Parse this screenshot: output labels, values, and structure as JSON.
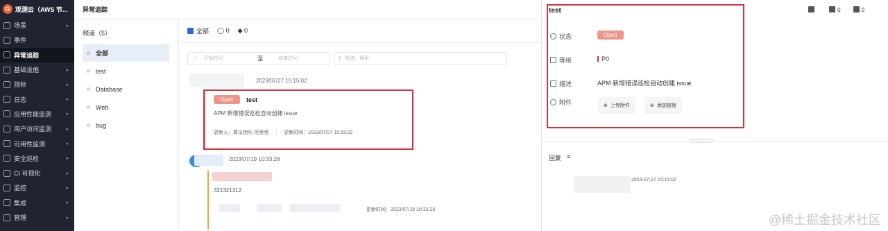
{
  "sidebar": {
    "brand": "观测云（AWS 节...",
    "items": [
      {
        "label": "场景",
        "has_arrow": true
      },
      {
        "label": "事件",
        "has_arrow": false
      },
      {
        "label": "异常追踪",
        "has_arrow": false,
        "active": true
      },
      {
        "label": "基础设施",
        "has_arrow": true
      },
      {
        "label": "指标",
        "has_arrow": true
      },
      {
        "label": "日志",
        "has_arrow": true
      },
      {
        "label": "应用性能监测",
        "has_arrow": true
      },
      {
        "label": "用户访问监测",
        "has_arrow": true
      },
      {
        "label": "可用性监测",
        "has_arrow": true
      },
      {
        "label": "安全巡检",
        "has_arrow": true
      },
      {
        "label": "CI 可视化",
        "has_arrow": true
      },
      {
        "label": "监控",
        "has_arrow": true
      },
      {
        "label": "集成",
        "has_arrow": true
      },
      {
        "label": "管理",
        "has_arrow": true
      }
    ]
  },
  "header": {
    "title": "异常追踪"
  },
  "channels": {
    "title": "频道（5）",
    "items": [
      "全部",
      "test",
      "Database",
      "Web",
      "bug"
    ]
  },
  "list": {
    "head_label": "全部",
    "member_count": "0",
    "bell_count": "0",
    "date_start_placeholder": "开始时间",
    "date_sep": "至",
    "date_end_placeholder": "结束时间",
    "search_placeholder": "筛选、搜索",
    "entry1": {
      "time": "2023/07/27 15:15:02",
      "badge": "Open",
      "title": "test",
      "desc": "APM 新增错误巡检自动创建 issue",
      "updater_label": "更新人：",
      "updater": "算法团队-范莹莹",
      "updated_label": "更新时间：",
      "updated": "2023/07/27 15:15:02"
    },
    "entry2": {
      "time": "2023/07/19 10:33:28",
      "desc": "321321312",
      "updated_label": "更新时间：",
      "updated": "2023/07/19 10:33:28"
    }
  },
  "drawer": {
    "title": "test",
    "comment_count": "0",
    "bell_count": "0",
    "status_label": "状态",
    "status_value": "Open",
    "level_label": "等级",
    "level_value": "P0",
    "desc_label": "描述",
    "desc_value": "APM 新增错误巡检自动创建 issue",
    "attach_label": "附件",
    "upload_label": "上传附件",
    "link_label": "添加链接",
    "reply_label": "回复",
    "reply_time": "2023-07-27 15:15:02"
  },
  "watermark": "@稀土掘金技术社区",
  "colors": {
    "accent": "#2b6cd4",
    "open_badge": "#f1948a",
    "highlight_box": "#d9313a",
    "sidebar_bg": "#1f2430"
  }
}
